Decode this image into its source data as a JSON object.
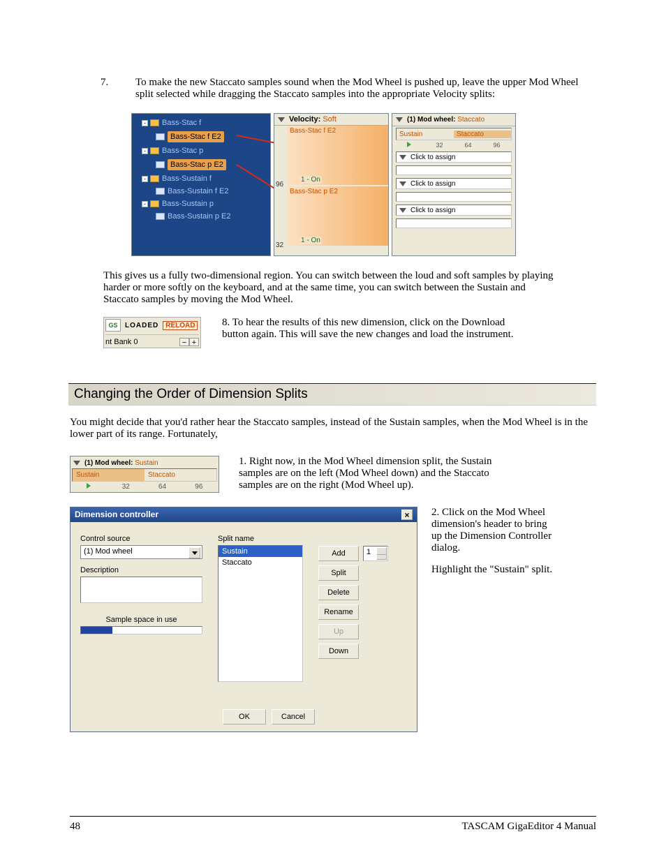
{
  "step7": {
    "num": "7.",
    "text": "To make the new Staccato samples sound when the Mod Wheel is pushed up, leave the upper Mod Wheel split selected while dragging the Staccato samples into the appropriate Velocity splits:"
  },
  "strip": {
    "tree": [
      {
        "type": "folder",
        "label": "Bass-Stac f"
      },
      {
        "type": "wave",
        "label": "Bass-Stac f E2",
        "indent": 1,
        "sel": true
      },
      {
        "type": "folder",
        "label": "Bass-Stac p"
      },
      {
        "type": "wave",
        "label": "Bass-Stac p E2",
        "indent": 1,
        "sel": true
      },
      {
        "type": "folder",
        "label": "Bass-Sustain f"
      },
      {
        "type": "wave",
        "label": "Bass-Sustain f E2",
        "indent": 1
      },
      {
        "type": "folder",
        "label": "Bass-Sustain p"
      },
      {
        "type": "wave",
        "label": "Bass-Sustain p E2",
        "indent": 1
      }
    ],
    "velocity": {
      "head_label": "Velocity:",
      "head_value": "Soft",
      "top_label": "Bass-Stac f E2",
      "axis_top": "96",
      "on_top": "1 - On",
      "bot_label": "Bass-Stac p E2",
      "axis_bot": "32",
      "on_bot": "1 - On"
    },
    "modwheel": {
      "head_prefix": "(1) Mod wheel:",
      "head_value": "Staccato",
      "split_left": "Sustain",
      "split_right": "Staccato",
      "ticks": [
        "32",
        "64",
        "96"
      ],
      "assign": "Click to assign"
    }
  },
  "para2": "This gives us a fully two-dimensional region.  You can switch between the loud and soft samples by playing harder or more softly on the keyboard, and at the same time, you can switch between the Sustain and Staccato samples by moving the Mod Wheel.",
  "thumb": {
    "gs": "GS",
    "loaded": "LOADED",
    "reload": "RELOAD",
    "bank": "nt Bank 0",
    "minus": "−",
    "plus": "+"
  },
  "step8": "8. To hear the results of this new dimension, click on the Download button again. This will save the new changes and load the instrument.",
  "heading": "Changing the Order of Dimension Splits",
  "paraA": "You might decide that you'd rather hear the Staccato samples, instead of the Sustain samples, when the Mod Wheel is in the lower part of its range.  Fortunately,",
  "mws": {
    "head_prefix": "(1) Mod wheel:",
    "head_value": "Sustain",
    "left": "Sustain",
    "right": "Staccato",
    "ticks": [
      "32",
      "64",
      "96"
    ]
  },
  "step1": "1. Right now, in the Mod Wheel dimension split, the Sustain samples are on the left (Mod Wheel down) and the Staccato samples are on the right (Mod Wheel up).",
  "dlg": {
    "title": "Dimension controller",
    "close": "×",
    "ctrl_src_lbl": "Control source",
    "ctrl_src_val": "(1) Mod wheel",
    "desc_lbl": "Description",
    "ssu_lbl": "Sample space in use",
    "splitname_lbl": "Split name",
    "splits": [
      "Sustain",
      "Staccato"
    ],
    "btn_add": "Add",
    "spin_val": "1",
    "btn_split": "Split",
    "btn_delete": "Delete",
    "btn_rename": "Rename",
    "btn_up": "Up",
    "btn_down": "Down",
    "ok": "OK",
    "cancel": "Cancel"
  },
  "right_text": {
    "p1": "2. Click on the Mod Wheel dimension's header to bring up the Dimension Controller dialog.",
    "p2": "Highlight the \"Sustain\" split."
  },
  "footer": {
    "page": "48",
    "title": "TASCAM GigaEditor 4 Manual"
  }
}
